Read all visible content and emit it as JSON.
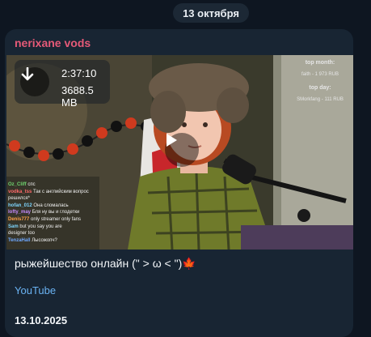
{
  "date_separator": "13 октября",
  "channel": {
    "name": "nerixane vods"
  },
  "video": {
    "duration": "2:37:10",
    "size": "3688.5 MB",
    "overlay": {
      "top_month_label": "top month:",
      "top_month_value": "faith - 1 973 RUB",
      "top_day_label": "top day:",
      "top_day_value": "SMorkfang - 111 RUB"
    },
    "chat": [
      {
        "nick": "Oz_Cliff",
        "text": "спс",
        "color": "#6fd36f"
      },
      {
        "nick": "vodka_tss",
        "text": "Так с английским вопрос",
        "color": "#ff6a6a"
      },
      {
        "nick": "",
        "text": "решился*",
        "color": "#ffffff"
      },
      {
        "nick": "hofan_012",
        "text": "Она сломалась",
        "color": "#7ed6ff"
      },
      {
        "nick": "lofty_may",
        "text": "Бля ну вы и глодетки",
        "color": "#c58bff"
      },
      {
        "nick": "Denis777",
        "text": "only streamer only fans",
        "color": "#ffa24a"
      },
      {
        "nick": "Sam",
        "text": "but you say you are",
        "color": "#7ed6ff"
      },
      {
        "nick": "",
        "text": "designer too",
        "color": "#ffffff"
      },
      {
        "nick": "TenzaHall",
        "text": "Лысожопч?",
        "color": "#6fa8ff"
      }
    ]
  },
  "caption": "рыжейшество онлайн (\" > ω < \")🍁",
  "link_text": "YouTube",
  "post_date": "13.10.2025",
  "colors": {
    "background": "#0e1621",
    "bubble": "#182533",
    "channel_name": "#e65a78",
    "link": "#6ab3f3"
  }
}
